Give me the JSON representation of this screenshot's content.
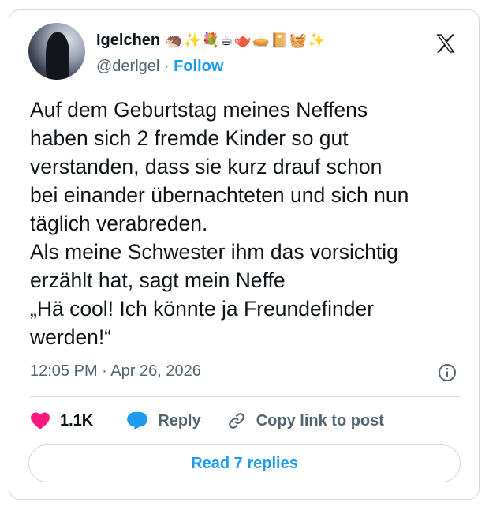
{
  "author": {
    "display_name": "Igelchen",
    "emojis": "🦔✨💐☕🫖🥧📔🧺✨",
    "handle": "@derlgel",
    "follow_label": "Follow"
  },
  "tweet": {
    "text": "Auf dem Geburtstag meines Neffens\nhaben sich 2 fremde Kinder so gut\nverstanden, dass sie kurz drauf schon\nbei einander übernachteten und sich nun\ntäglich verabreden.\nAls meine Schwester ihm das vorsichtig\nerzählt hat, sagt mein Neffe\n„Hä cool! Ich könnte ja Freundefinder\nwerden!“",
    "time": "12:05 PM",
    "date": "Apr 26, 2026"
  },
  "actions": {
    "like_count": "1.1K",
    "reply_label": "Reply",
    "copy_link_label": "Copy link to post"
  },
  "read_replies_label": "Read 7 replies",
  "colors": {
    "accent": "#1d9bf0",
    "like": "#f91880",
    "text": "#0f1419",
    "muted": "#536471",
    "border": "#cfd9de"
  },
  "icons": [
    "x-logo-icon",
    "info-icon",
    "heart-icon",
    "reply-bubble-icon",
    "link-icon"
  ]
}
